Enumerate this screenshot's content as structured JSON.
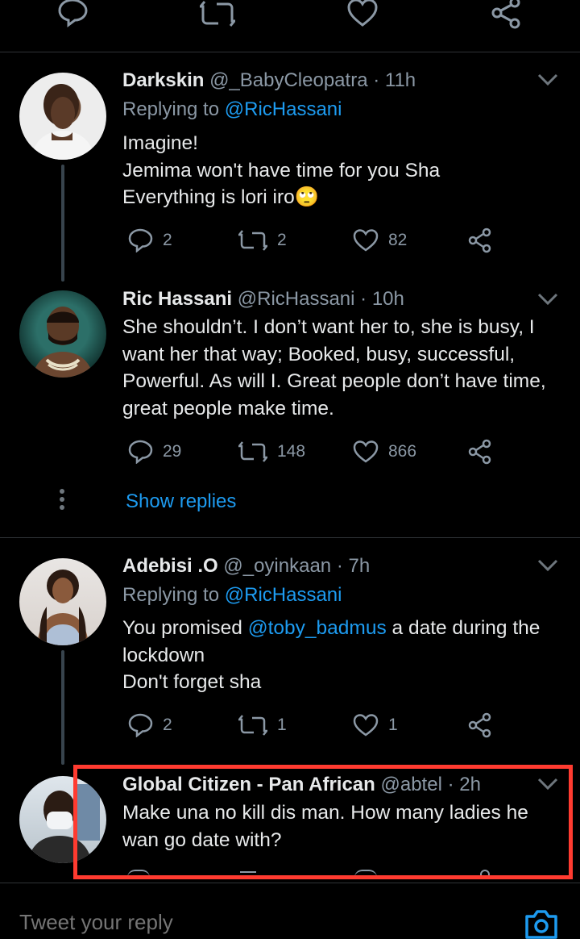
{
  "top_actions": [
    "reply-icon",
    "retweet-icon",
    "like-icon",
    "share-icon"
  ],
  "tweets": [
    {
      "name": "Darkskin",
      "handle": "@_BabyCleopatra",
      "time": "· 11h",
      "replying_prefix": "Replying to ",
      "replying_to": "@RicHassani",
      "lines": [
        "Imagine!",
        "Jemima won't have time for you Sha",
        "Everything is lori iro🙄"
      ],
      "replies": "2",
      "retweets": "2",
      "likes": "82"
    },
    {
      "name": "Ric Hassani",
      "handle": "@RicHassani",
      "time": "· 10h",
      "lines": [
        "She shouldn’t. I don’t want her to, she is busy, I",
        "want her that way; Booked, busy, successful,",
        "Powerful. As will I. Great people don’t have time,",
        "great people make time."
      ],
      "replies": "29",
      "retweets": "148",
      "likes": "866"
    },
    {
      "name": "Adebisi .O",
      "handle": "@_oyinkaan",
      "time": "· 7h",
      "replying_prefix": "Replying to ",
      "replying_to": "@RicHassani",
      "line1_pre": "You promised ",
      "line1_mention": "@toby_badmus",
      "line1_post": " a date during the",
      "lines": [
        "lockdown",
        "Don't forget sha"
      ],
      "replies": "2",
      "retweets": "1",
      "likes": "1"
    },
    {
      "name": "Global Citizen - Pan African",
      "handle": "@abtel",
      "time": "· 2h",
      "lines": [
        "Make una no kill dis man. How many ladies he",
        "wan go date with?"
      ]
    }
  ],
  "show_replies": "Show replies",
  "reply_placeholder": "Tweet your reply",
  "colors": {
    "background": "#000000",
    "accent": "#1d9bf0",
    "muted": "#8b98a5",
    "highlight": "#ff3b30"
  }
}
